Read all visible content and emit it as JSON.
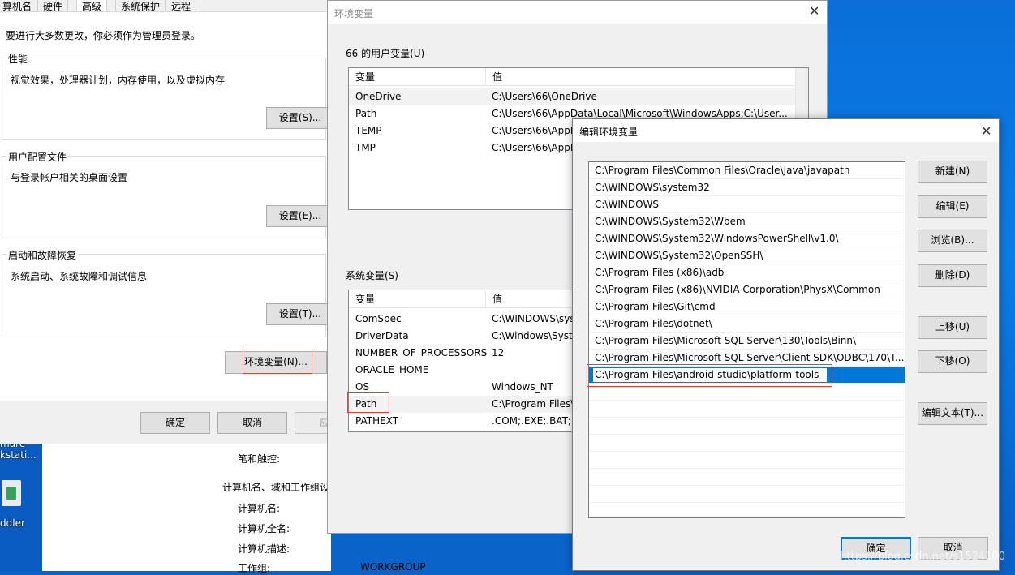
{
  "sys_props": {
    "tabs": [
      "算机名",
      "硬件",
      "高级",
      "系统保护",
      "远程"
    ],
    "admin_note": "要进行大多数更改，你必须作为管理员登录。",
    "performance": {
      "title": "性能",
      "desc": "视觉效果，处理器计划，内存使用，以及虚拟内存",
      "button": "设置(S)..."
    },
    "user_profile": {
      "title": "用户配置文件",
      "desc": "与登录帐户相关的桌面设置",
      "button": "设置(E)..."
    },
    "startup": {
      "title": "启动和故障恢复",
      "desc": "系统启动、系统故障和调试信息",
      "button": "设置(T)..."
    },
    "env_button": "环境变量(N)...",
    "ok": "确定",
    "cancel": "取消",
    "apply": "应用"
  },
  "system_info": {
    "pen_touch": "笔和触控:",
    "section": "计算机名、域和工作组设",
    "computer_name": "计算机名:",
    "full_name": "计算机全名:",
    "description": "计算机描述:",
    "workgroup_label": "工作组:",
    "workgroup_value": "WORKGROUP"
  },
  "desktop": {
    "icon_label_1": "kstati...",
    "icon_label_2": "ddler",
    "icon_label_top": "mare"
  },
  "env_dialog": {
    "title": "环境变量",
    "user_section": "66 的用户变量(U)",
    "col_var": "变量",
    "col_val": "值",
    "user_vars": [
      {
        "name": "OneDrive",
        "value": "C:\\Users\\66\\OneDrive"
      },
      {
        "name": "Path",
        "value": "C:\\Users\\66\\AppData\\Local\\Microsoft\\WindowsApps;C:\\User..."
      },
      {
        "name": "TEMP",
        "value": "C:\\Users\\66\\AppD"
      },
      {
        "name": "TMP",
        "value": "C:\\Users\\66\\AppD"
      }
    ],
    "system_section": "系统变量(S)",
    "system_vars": [
      {
        "name": "ComSpec",
        "value": "C:\\WINDOWS\\sys"
      },
      {
        "name": "DriverData",
        "value": "C:\\Windows\\Syste"
      },
      {
        "name": "NUMBER_OF_PROCESSORS",
        "value": "12"
      },
      {
        "name": "ORACLE_HOME",
        "value": ""
      },
      {
        "name": "OS",
        "value": "Windows_NT"
      },
      {
        "name": "Path",
        "value": "C:\\Program Files\\"
      },
      {
        "name": "PATHEXT",
        "value": ".COM;.EXE;.BAT;.C"
      }
    ]
  },
  "edit_dialog": {
    "title": "编辑环境变量",
    "paths": [
      "C:\\Program Files\\Common Files\\Oracle\\Java\\javapath",
      "C:\\WINDOWS\\system32",
      "C:\\WINDOWS",
      "C:\\WINDOWS\\System32\\Wbem",
      "C:\\WINDOWS\\System32\\WindowsPowerShell\\v1.0\\",
      "C:\\WINDOWS\\System32\\OpenSSH\\",
      "C:\\Program Files (x86)\\adb",
      "C:\\Program Files (x86)\\NVIDIA Corporation\\PhysX\\Common",
      "C:\\Program Files\\Git\\cmd",
      "C:\\Program Files\\dotnet\\",
      "C:\\Program Files\\Microsoft SQL Server\\130\\Tools\\Binn\\",
      "C:\\Program Files\\Microsoft SQL Server\\Client SDK\\ODBC\\170\\T..."
    ],
    "editing_value": "C:\\Program Files\\android-studio\\platform-tools",
    "buttons": {
      "new": "新建(N)",
      "edit": "编辑(E)",
      "browse": "浏览(B)...",
      "delete": "删除(D)",
      "move_up": "上移(U)",
      "move_down": "下移(O)",
      "edit_text": "编辑文本(T)..."
    },
    "ok": "确定",
    "cancel": "取消"
  },
  "watermark": "https://blog.csdn.net/s1524100"
}
